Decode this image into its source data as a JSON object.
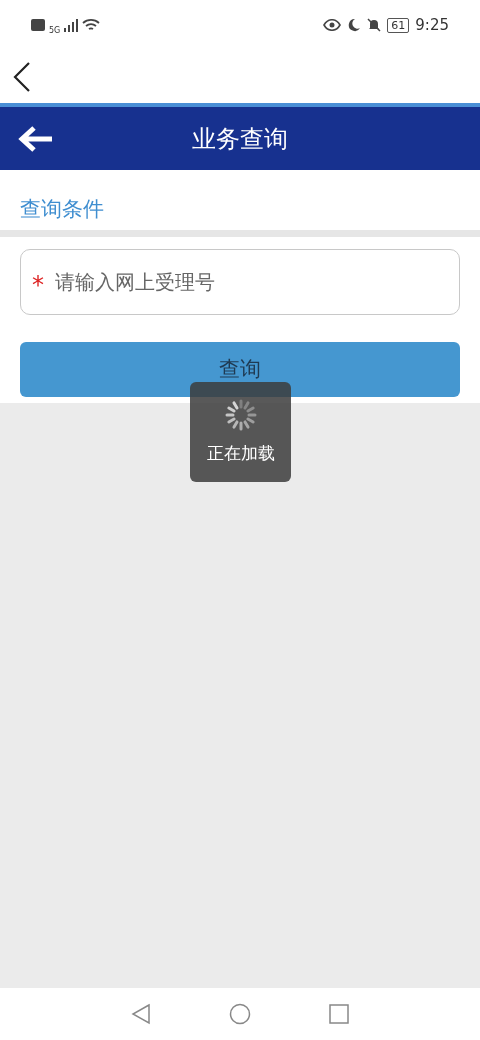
{
  "status_bar": {
    "network": "5G",
    "battery": "61",
    "time": "9:25"
  },
  "header": {
    "title": "业务查询"
  },
  "section": {
    "title": "查询条件"
  },
  "form": {
    "field": {
      "required_mark": "*",
      "placeholder": "请输入网上受理号"
    },
    "button": "查询"
  },
  "loading": {
    "text": "正在加载"
  }
}
